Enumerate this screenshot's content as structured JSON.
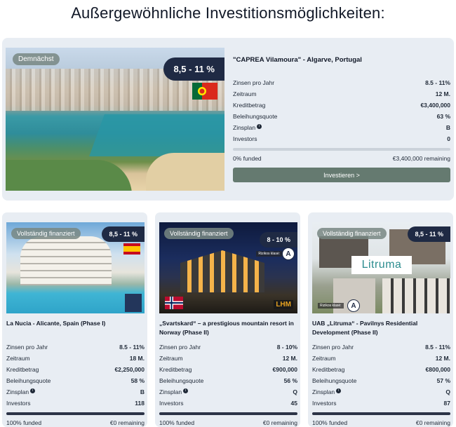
{
  "heading": "Außergewöhnliche Investitionsmöglichkeiten:",
  "featured": {
    "badge": "Demnächst",
    "rate": "8,5 - 11 %",
    "title": "\"CAPREA Vilamoura\" - Algarve, Portugal",
    "rows": [
      {
        "label": "Zinsen pro Jahr",
        "value": "8.5 - 11%"
      },
      {
        "label": "Zeitraum",
        "value": "12 M."
      },
      {
        "label": "Kreditbetrag",
        "value": "€3,400,000"
      },
      {
        "label": "Beleihungsquote",
        "value": "63 %"
      },
      {
        "label": "Zinsplan",
        "value": "B"
      },
      {
        "label": "Investors",
        "value": "0"
      }
    ],
    "funded": "0% funded",
    "remaining": "€3,400,000 remaining",
    "funded_fraction": 0,
    "button": "Investieren >"
  },
  "cards": [
    {
      "badge": "Vollständig finanziert",
      "rate": "8,5 - 11 %",
      "title": "La Nucia - Alicante, Spain (Phase I)",
      "rows": [
        {
          "label": "Zinsen pro Jahr",
          "value": "8.5 - 11%"
        },
        {
          "label": "Zeitraum",
          "value": "18 M."
        },
        {
          "label": "Kreditbetrag",
          "value": "€2,250,000"
        },
        {
          "label": "Beleihungsquote",
          "value": "58 %"
        },
        {
          "label": "Zinsplan",
          "value": "B"
        },
        {
          "label": "Investors",
          "value": "118"
        }
      ],
      "funded": "100% funded",
      "remaining": "€0 remaining",
      "funded_fraction": 1
    },
    {
      "badge": "Vollständig finanziert",
      "rate": "8 - 10 %",
      "risk_label": "Rizikos klasė:",
      "risk_class": "A",
      "logo": "LHM",
      "title": "„Svartskard“ – a prestigious mountain resort in Norway (Phase II)",
      "rows": [
        {
          "label": "Zinsen pro Jahr",
          "value": "8 - 10%"
        },
        {
          "label": "Zeitraum",
          "value": "12 M."
        },
        {
          "label": "Kreditbetrag",
          "value": "€900,000"
        },
        {
          "label": "Beleihungsquote",
          "value": "56 %"
        },
        {
          "label": "Zinsplan",
          "value": "Q"
        },
        {
          "label": "Investors",
          "value": "45"
        }
      ],
      "funded": "100% funded",
      "remaining": "€0 remaining",
      "funded_fraction": 1
    },
    {
      "badge": "Vollständig finanziert",
      "rate": "8,5 - 11 %",
      "risk_label": "Rizikos klasė:",
      "risk_class": "A",
      "logo": "Litruma",
      "title": "UAB „Litruma“ - Pavilnys Residential Development (Phase II)",
      "rows": [
        {
          "label": "Zinsen pro Jahr",
          "value": "8.5 - 11%"
        },
        {
          "label": "Zeitraum",
          "value": "12 M."
        },
        {
          "label": "Kreditbetrag",
          "value": "€800,000"
        },
        {
          "label": "Beleihungsquote",
          "value": "57 %"
        },
        {
          "label": "Zinsplan",
          "value": "Q"
        },
        {
          "label": "Investors",
          "value": "87"
        }
      ],
      "funded": "100% funded",
      "remaining": "€0 remaining",
      "funded_fraction": 1
    }
  ],
  "info_icon": "info-icon"
}
